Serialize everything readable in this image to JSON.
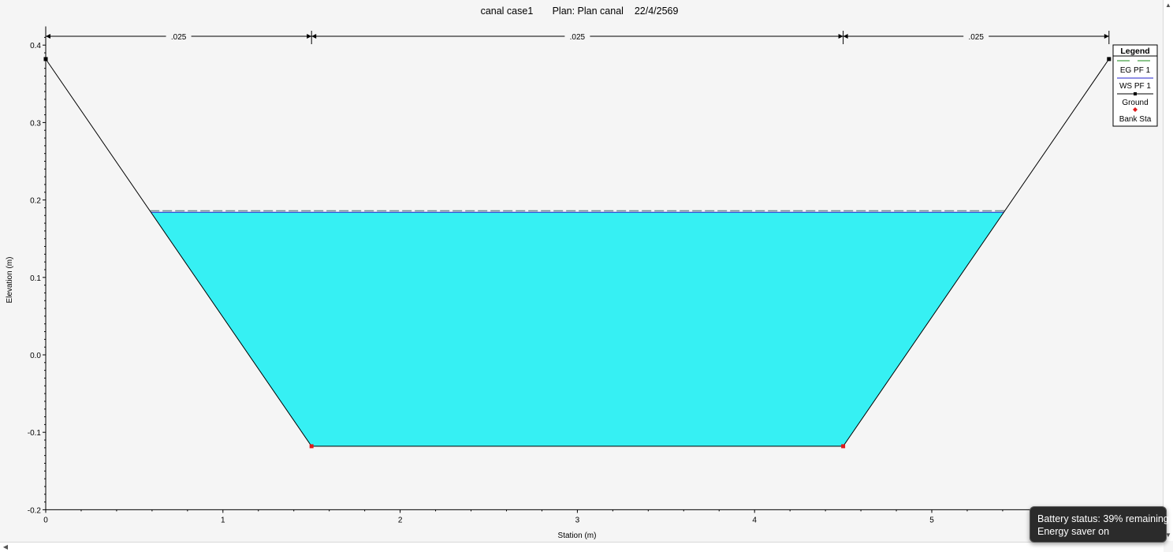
{
  "chart_data": {
    "type": "area",
    "title": "canal case1       Plan: Plan canal    22/4/2569",
    "xlabel": "Station (m)",
    "ylabel": "Elevation (m)",
    "xlim": [
      0,
      5.6
    ],
    "ylim": [
      -0.2,
      0.42
    ],
    "x_ticks": [
      0,
      1,
      2,
      3,
      4,
      5
    ],
    "y_ticks": [
      -0.2,
      -0.1,
      0.0,
      0.1,
      0.2,
      0.3,
      0.4
    ],
    "x_tick_labels": [
      "0",
      "1",
      "2",
      "3",
      "4",
      "5"
    ],
    "y_tick_labels": [
      "-0.2",
      "-0.1",
      "0.0",
      "0.1",
      "0.2",
      "0.3",
      "0.4"
    ],
    "ground": {
      "name": "Ground",
      "x": [
        0,
        1.5,
        4.5,
        6.0
      ],
      "y": [
        0.382,
        -0.118,
        -0.118,
        0.382
      ]
    },
    "bank_stations": {
      "name": "Bank Sta",
      "x": [
        1.5,
        4.5
      ],
      "y": [
        -0.118,
        -0.118
      ]
    },
    "ws": {
      "name": "WS PF 1",
      "elevation": 0.184
    },
    "eg": {
      "name": "EG PF 1",
      "elevation": 0.186
    },
    "manning_n": {
      "values": [
        ".025",
        ".025",
        ".025"
      ],
      "boundaries": [
        0,
        1.5,
        4.5,
        6.0
      ]
    },
    "legend": {
      "title": "Legend",
      "placement": "top-right",
      "items": [
        "EG PF 1",
        "WS PF 1",
        "Ground",
        "Bank Sta"
      ]
    },
    "colors": {
      "water": "#36f0f3",
      "eg": "#1a8a1a",
      "ws": "#2222cc",
      "ground": "#000000",
      "bank": "#e0191b"
    }
  },
  "tooltip": {
    "line1": "Battery status: 39% remaining",
    "line2": "Energy saver on"
  }
}
